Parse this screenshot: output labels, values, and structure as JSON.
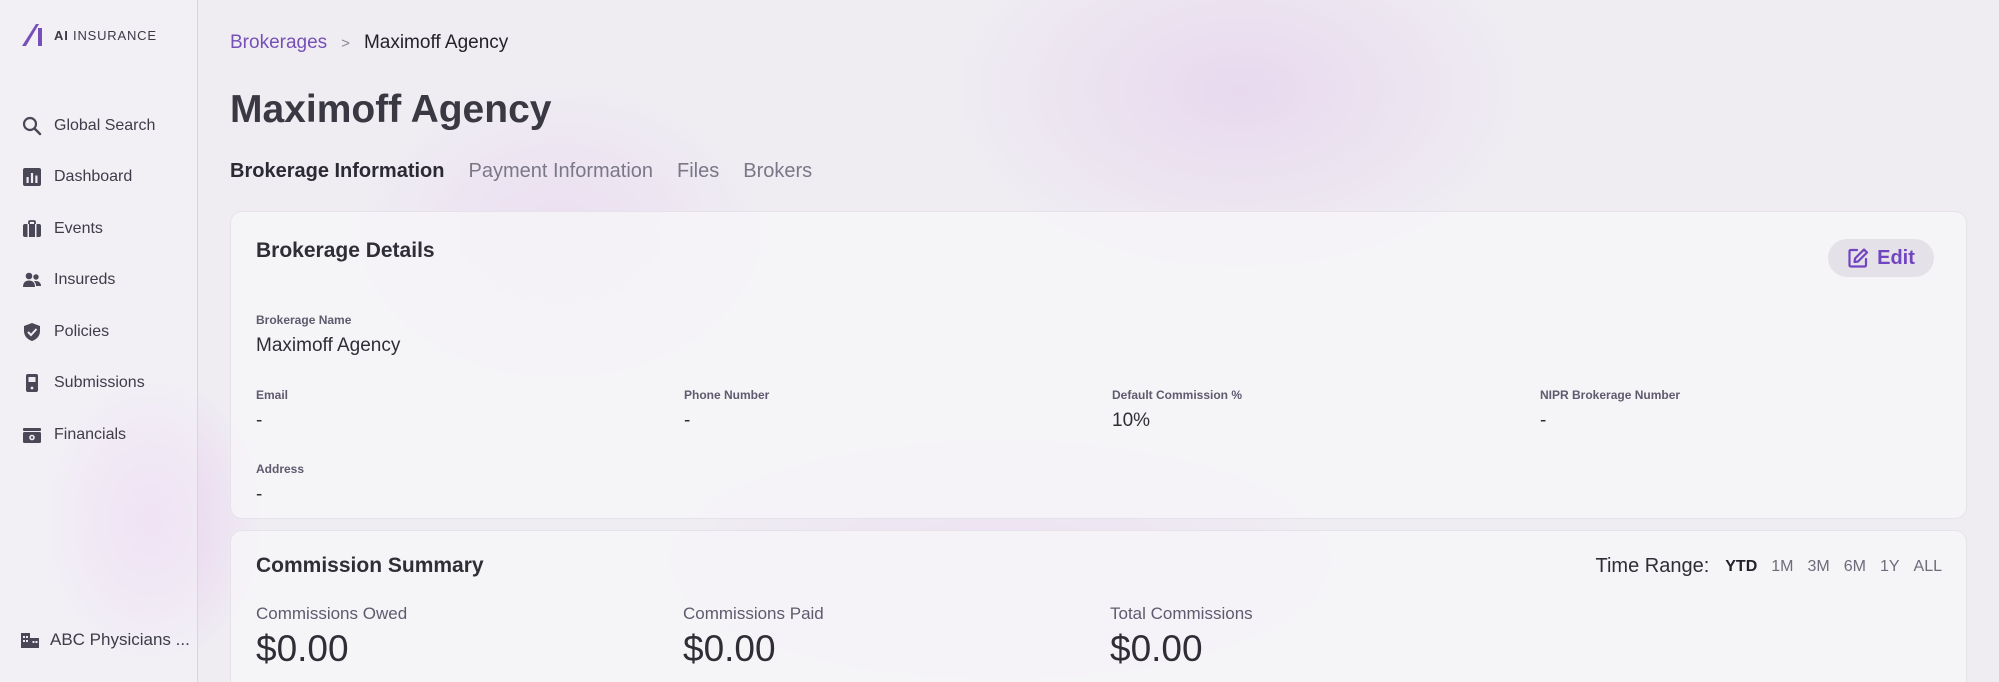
{
  "brand": {
    "name_bold": "AI",
    "name_light": "INSURANCE",
    "accent": "#7650b8"
  },
  "sidebar": {
    "items": [
      {
        "label": "Global Search",
        "icon": "search-icon"
      },
      {
        "label": "Dashboard",
        "icon": "chart-icon"
      },
      {
        "label": "Events",
        "icon": "briefcase-icon"
      },
      {
        "label": "Insureds",
        "icon": "users-icon"
      },
      {
        "label": "Policies",
        "icon": "shield-icon"
      },
      {
        "label": "Submissions",
        "icon": "phone-icon"
      },
      {
        "label": "Financials",
        "icon": "money-icon"
      }
    ],
    "org": {
      "label": "ABC Physicians ...",
      "icon": "building-icon"
    }
  },
  "breadcrumb": {
    "parent": "Brokerages",
    "separator": ">",
    "current": "Maximoff Agency"
  },
  "page": {
    "title": "Maximoff Agency"
  },
  "tabs": [
    "Brokerage Information",
    "Payment Information",
    "Files",
    "Brokers"
  ],
  "details": {
    "title": "Brokerage Details",
    "edit_label": "Edit",
    "brokerage_name_label": "Brokerage Name",
    "brokerage_name": "Maximoff Agency",
    "email_label": "Email",
    "email": "-",
    "phone_label": "Phone Number",
    "phone": "-",
    "commission_label": "Default Commission %",
    "commission": "10%",
    "nipr_label": "NIPR Brokerage Number",
    "nipr": "-",
    "address_label": "Address",
    "address": "-"
  },
  "commission": {
    "title": "Commission Summary",
    "time_range_label": "Time Range:",
    "ranges": [
      "YTD",
      "1M",
      "3M",
      "6M",
      "1Y",
      "ALL"
    ],
    "selected_range": "YTD",
    "owed_label": "Commissions Owed",
    "owed": "$0.00",
    "paid_label": "Commissions Paid",
    "paid": "$0.00",
    "total_label": "Total Commissions",
    "total": "$0.00"
  }
}
